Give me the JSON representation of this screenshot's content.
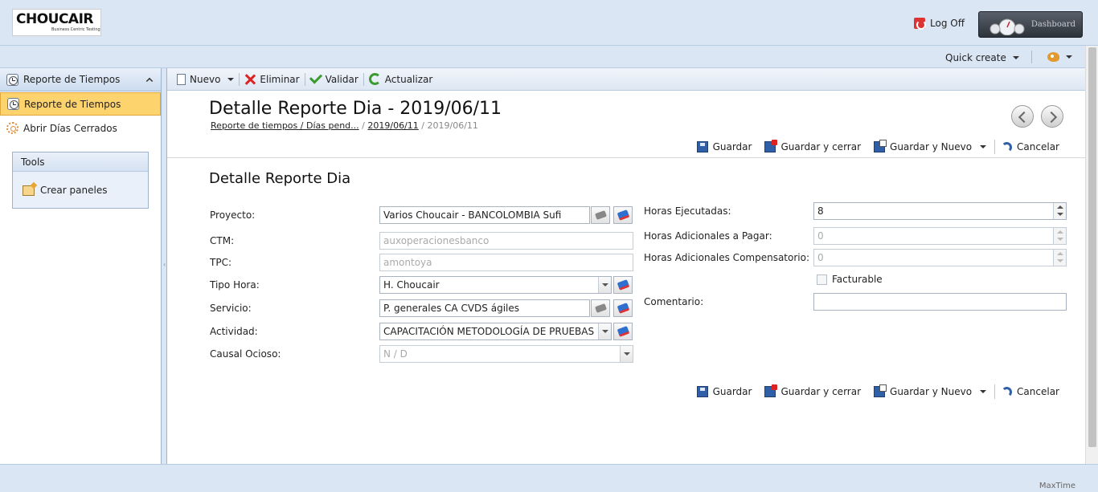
{
  "header": {
    "logo": {
      "word": "CHOUCAIR",
      "tagline": "Business Centric Testing"
    },
    "logoff_label": "Log Off",
    "dashboard_label": "Dashboard"
  },
  "quickbar": {
    "quick_create_label": "Quick create"
  },
  "sidebar": {
    "section_title": "Reporte de Tiempos",
    "items": [
      {
        "label": "Reporte de Tiempos",
        "active": true
      },
      {
        "label": "Abrir Días Cerrados",
        "active": false
      }
    ],
    "tools": {
      "title": "Tools",
      "items": [
        {
          "label": "Crear paneles"
        }
      ]
    }
  },
  "toolbar": {
    "new_label": "Nuevo",
    "delete_label": "Eliminar",
    "validate_label": "Validar",
    "refresh_label": "Actualizar"
  },
  "page": {
    "title": "Detalle Reporte Dia - 2019/06/11",
    "breadcrumb": {
      "link1": "Reporte de tiempos / Días pend...",
      "link2": "2019/06/11",
      "current": "2019/06/11",
      "sep": "/"
    },
    "section_title": "Detalle Reporte Dia"
  },
  "actions": {
    "save": "Guardar",
    "save_close": "Guardar y cerrar",
    "save_new": "Guardar y Nuevo",
    "cancel": "Cancelar"
  },
  "form": {
    "left": [
      {
        "label": "Proyecto:",
        "value": "Varios Choucair - BANCOLOMBIA Sufi"
      },
      {
        "label": "CTM:",
        "value": "auxoperacionesbanco"
      },
      {
        "label": "TPC:",
        "value": "amontoya"
      },
      {
        "label": "Tipo Hora:",
        "value": "H. Choucair"
      },
      {
        "label": "Servicio:",
        "value": "P. generales CA CVDS ágiles"
      },
      {
        "label": "Actividad:",
        "value": "CAPACITACIÓN METODOLOGÍA DE PRUEBAS"
      },
      {
        "label": "Causal Ocioso:",
        "value": "N / D"
      }
    ],
    "right": [
      {
        "label": "Horas Ejecutadas:",
        "value": "8"
      },
      {
        "label": "Horas Adicionales a Pagar:",
        "value": "0"
      },
      {
        "label": "Horas Adicionales Compensatorio:",
        "value": "0"
      },
      {
        "label": "Facturable",
        "checked": false
      },
      {
        "label": "Comentario:",
        "value": ""
      }
    ]
  },
  "footer": {
    "brand": "MaxTime"
  },
  "colors": {
    "accent_active": "#fdd36d",
    "frame": "#dbe6f4",
    "brand_blue": "#2f5fa6"
  }
}
